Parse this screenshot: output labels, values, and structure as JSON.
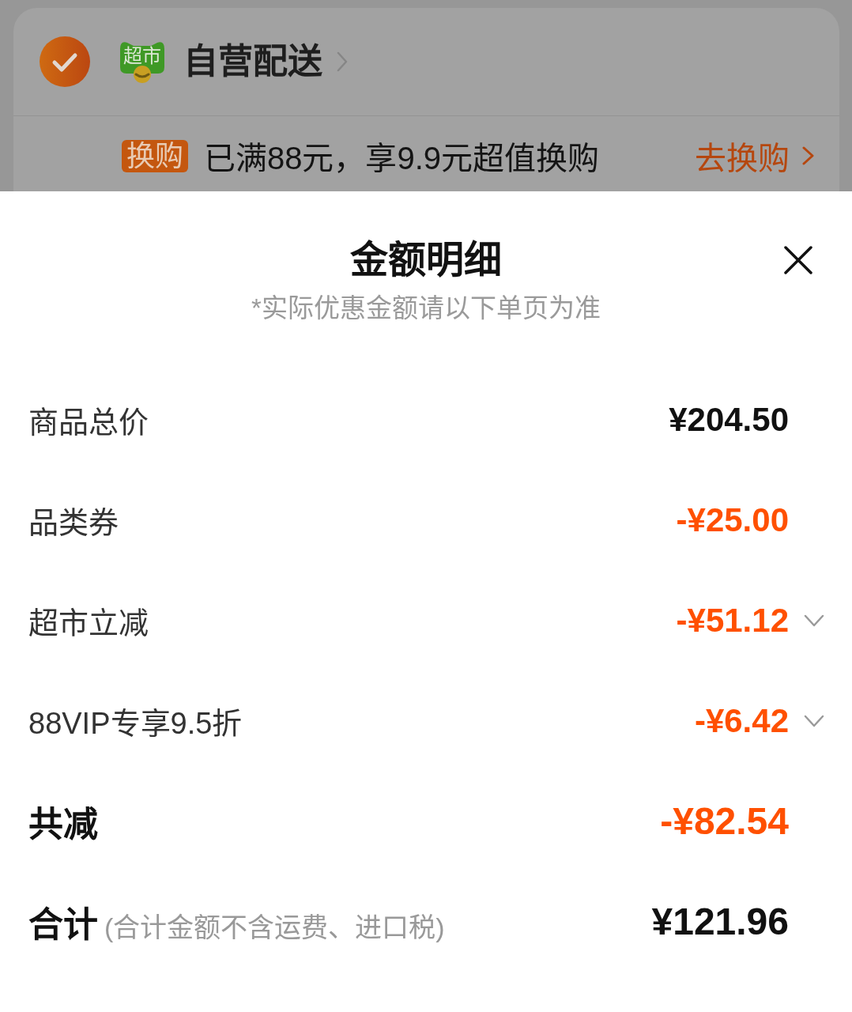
{
  "store": {
    "checked": true,
    "logo_text": "超市",
    "name": "自营配送"
  },
  "promo": {
    "badge": "换购",
    "text": "已满88元，享9.9元超值换购",
    "action": "去换购"
  },
  "sheet": {
    "title": "金额明细",
    "note": "*实际优惠金额请以下单页为准"
  },
  "rows": [
    {
      "kind": "price",
      "label": "商品总价",
      "amount": "¥204.50",
      "expandable": false
    },
    {
      "kind": "discount",
      "label": "品类券",
      "amount": "-¥25.00",
      "expandable": false
    },
    {
      "kind": "discount",
      "label": "超市立减",
      "amount": "-¥51.12",
      "expandable": true
    },
    {
      "kind": "discount",
      "label": "88VIP专享9.5折",
      "amount": "-¥6.42",
      "expandable": true
    },
    {
      "kind": "discount_total",
      "label": "共减",
      "amount": "-¥82.54",
      "expandable": false
    },
    {
      "kind": "total",
      "label": "合计",
      "note": "(合计金额不含运费、进口税)",
      "amount": "¥121.96",
      "expandable": false
    }
  ]
}
